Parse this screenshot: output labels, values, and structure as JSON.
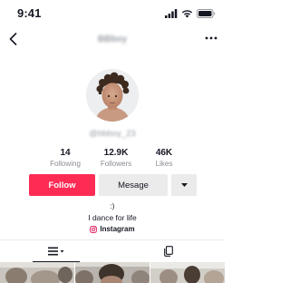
{
  "status_bar": {
    "time": "9:41",
    "icons": [
      "cellular-signal-icon",
      "wifi-icon",
      "battery-icon"
    ]
  },
  "nav": {
    "back_icon": "chevron-left-icon",
    "title": "BBboy",
    "more_icon": "more-horizontal-icon"
  },
  "profile": {
    "username": "@bbboy_23"
  },
  "stats": [
    {
      "value": "14",
      "label": "Following"
    },
    {
      "value": "12.9K",
      "label": "Followers"
    },
    {
      "value": "46K",
      "label": "Likes"
    }
  ],
  "actions": {
    "follow_label": "Follow",
    "message_label": "Mesage",
    "dropdown_icon": "caret-down-icon"
  },
  "bio": {
    "emoticon": ":)",
    "text": "I dance for life",
    "link_label": "Instagram",
    "link_icon": "instagram-icon"
  },
  "tabs": [
    {
      "icon": "grid-list-icon",
      "active": true
    },
    {
      "icon": "liked-videos-icon",
      "active": false
    }
  ],
  "colors": {
    "accent": "#fe2c55",
    "instagram": "#e1306c",
    "text": "#161823",
    "muted": "#8a8b91",
    "button_gray": "#ebebeb"
  }
}
